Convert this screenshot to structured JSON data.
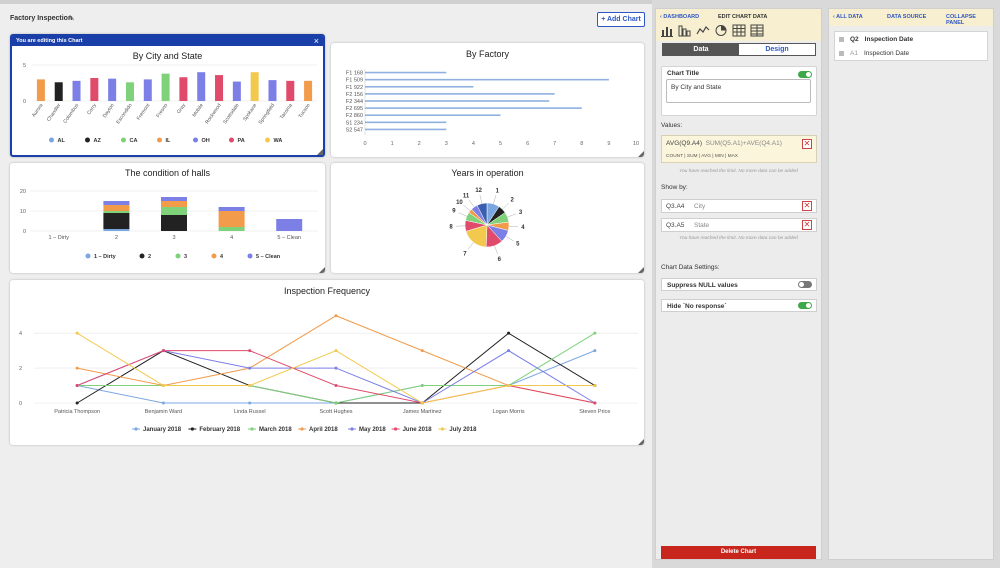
{
  "dashboard": {
    "title": "Factory Inspection",
    "add_chart_label": "+ Add Chart",
    "editing_banner": "You are editing this Chart",
    "close_glyph": "×",
    "pencil_glyph": "✎"
  },
  "chart_data": [
    {
      "id": "city_state",
      "type": "bar",
      "title": "By City and State",
      "categories": [
        "Aurora",
        "Chandler",
        "Columbus",
        "Corry",
        "Dayton",
        "Escondido",
        "Fremont",
        "Fresno",
        "Gray",
        "Mobile",
        "Rockwood",
        "Scottsdale",
        "Spokane",
        "Springfield",
        "Tacoma",
        "Tucson"
      ],
      "values": [
        3,
        2.6,
        2.8,
        3.2,
        3.1,
        2.6,
        3,
        3.8,
        3.3,
        4,
        3.6,
        2.7,
        4,
        2.9,
        2.8,
        2.8
      ],
      "colors": [
        "#f29b4b",
        "#222222",
        "#7b7fe6",
        "#e04a6b",
        "#7b7fe6",
        "#7fd17a",
        "#7b7fe6",
        "#7fd17a",
        "#e04a6b",
        "#7b7fe6",
        "#e04a6b",
        "#7b7fe6",
        "#f2c94c",
        "#7b7fe6",
        "#e04a6b",
        "#f29b4b"
      ],
      "yticks": [
        "0",
        "5"
      ],
      "ylim": [
        0,
        5
      ],
      "legend": [
        {
          "name": "AL",
          "color": "#7ba7e0"
        },
        {
          "name": "AZ",
          "color": "#222222"
        },
        {
          "name": "CA",
          "color": "#7fd17a"
        },
        {
          "name": "IL",
          "color": "#f29b4b"
        },
        {
          "name": "OH",
          "color": "#7b7fe6"
        },
        {
          "name": "PA",
          "color": "#e04a6b"
        },
        {
          "name": "WA",
          "color": "#f2c94c"
        }
      ]
    },
    {
      "id": "factory",
      "type": "bar",
      "orientation": "horizontal",
      "title": "By Factory",
      "categories": [
        "F1 168",
        "F1 509",
        "F1 922",
        "F2 156",
        "F2 344",
        "F2 695",
        "F2 860",
        "S1 234",
        "S2 547"
      ],
      "values": [
        3,
        9,
        4,
        7,
        6.8,
        8,
        5,
        3,
        3
      ],
      "xticks": [
        "0",
        "1",
        "2",
        "3",
        "4",
        "5",
        "6",
        "7",
        "8",
        "9",
        "10"
      ],
      "xlim": [
        0,
        10
      ],
      "color": "#8fb0e0"
    },
    {
      "id": "halls",
      "type": "bar",
      "stacked": true,
      "title": "The condition of halls",
      "categories": [
        "1 – Dirty",
        "2",
        "3",
        "4",
        "5 – Clean"
      ],
      "yticks": [
        "0",
        "10",
        "20"
      ],
      "ylim": [
        0,
        22
      ],
      "series": [
        {
          "name": "1 – Dirty",
          "color": "#7ba7e0",
          "values": [
            0,
            1,
            0,
            0,
            0
          ]
        },
        {
          "name": "2",
          "color": "#222222",
          "values": [
            0,
            8,
            8,
            0,
            0
          ]
        },
        {
          "name": "3",
          "color": "#7fd17a",
          "values": [
            0,
            1,
            4,
            2,
            0
          ]
        },
        {
          "name": "4",
          "color": "#f29b4b",
          "values": [
            0,
            3,
            3,
            8,
            0
          ]
        },
        {
          "name": "5 – Clean",
          "color": "#7b7fe6",
          "values": [
            0,
            2,
            2,
            2,
            6
          ]
        }
      ]
    },
    {
      "id": "years",
      "type": "pie",
      "title": "Years in operation",
      "labels": [
        "1",
        "2",
        "3",
        "4",
        "5",
        "6",
        "7",
        "8",
        "9",
        "10",
        "11",
        "12"
      ],
      "values": [
        1.5,
        1,
        1.2,
        1,
        1.5,
        2,
        3.2,
        1.3,
        1,
        0.5,
        0.8,
        1.2
      ],
      "colors": [
        "#7ba7e0",
        "#222222",
        "#7fd17a",
        "#f29b4b",
        "#7b7fe6",
        "#e04a6b",
        "#f2c94c",
        "#e04a6b",
        "#7fd17a",
        "#f29b4b",
        "#7b7fe6",
        "#3b5fb0"
      ]
    },
    {
      "id": "frequency",
      "type": "line",
      "title": "Inspection Frequency",
      "categories": [
        "Patricia Thompson",
        "Benjamin Ward",
        "Linda Russel",
        "Scott Hughes",
        "James Martinez",
        "Logan Morris",
        "Steven Price"
      ],
      "yticks": [
        "0",
        "2",
        "4"
      ],
      "ylim": [
        0,
        5.5
      ],
      "series": [
        {
          "name": "January 2018",
          "color": "#7ba7e0",
          "values": [
            1,
            0,
            0,
            0,
            1,
            1,
            3
          ]
        },
        {
          "name": "February 2018",
          "color": "#222222",
          "values": [
            0,
            3,
            1,
            0,
            0,
            4,
            1
          ]
        },
        {
          "name": "March 2018",
          "color": "#7fd17a",
          "values": [
            1,
            1,
            1,
            0,
            1,
            1,
            4
          ]
        },
        {
          "name": "April 2018",
          "color": "#f29b4b",
          "values": [
            2,
            1,
            2,
            5,
            3,
            1,
            0
          ]
        },
        {
          "name": "May 2018",
          "color": "#7b7fe6",
          "values": [
            1,
            3,
            2,
            2,
            0,
            3,
            0
          ]
        },
        {
          "name": "June 2018",
          "color": "#e04a6b",
          "values": [
            1,
            3,
            3,
            1,
            0,
            1,
            0
          ]
        },
        {
          "name": "July 2018",
          "color": "#f2c94c",
          "values": [
            4,
            1,
            1,
            3,
            0,
            1,
            1
          ]
        }
      ]
    }
  ],
  "edit_panel": {
    "back_label": "‹ DASHBOARD",
    "heading": "EDIT CHART DATA",
    "chart_type_icons": [
      "bar-chart-icon",
      "line-chart-icon",
      "area-chart-icon",
      "pie-chart-icon",
      "table-icon",
      "grid-icon"
    ],
    "tab_data": "Data",
    "tab_design": "Design",
    "chart_title_label": "Chart Title",
    "chart_title_value": "By City and State",
    "values_label": "Values:",
    "value_expr_main": "AVG(Q9.A4)",
    "value_expr_rest": "SUM(Q5.A1)+AVE(Q4.A1)",
    "value_options": "COUNT | SUM | AVG | MIN | MAX",
    "limit_note": "You have reached the limit. No more data can be added",
    "show_by_label": "Show by:",
    "show_by": [
      {
        "code": "Q3.A4",
        "name": "City"
      },
      {
        "code": "Q3.A5",
        "name": "State"
      }
    ],
    "settings_label": "Chart Data Settings:",
    "suppress_null_label": "Suppress NULL values",
    "hide_no_response_label": "Hide `No response`",
    "delete_label": "Delete Chart",
    "remove_glyph": "✕"
  },
  "data_source": {
    "all_data_label": "‹ ALL DATA",
    "heading": "DATA SOURCE",
    "collapse_label": "COLLAPSE PANEL",
    "items": [
      {
        "key": "Q2",
        "label": "Inspection Date"
      },
      {
        "key": "A1",
        "label": "Inspection Date"
      }
    ]
  },
  "colors": {
    "accent": "#2e57c6",
    "editing_border": "#1a3fa8",
    "delete": "#c8261d",
    "toggle_on": "#3da84a",
    "toggle_off": "#777777"
  }
}
